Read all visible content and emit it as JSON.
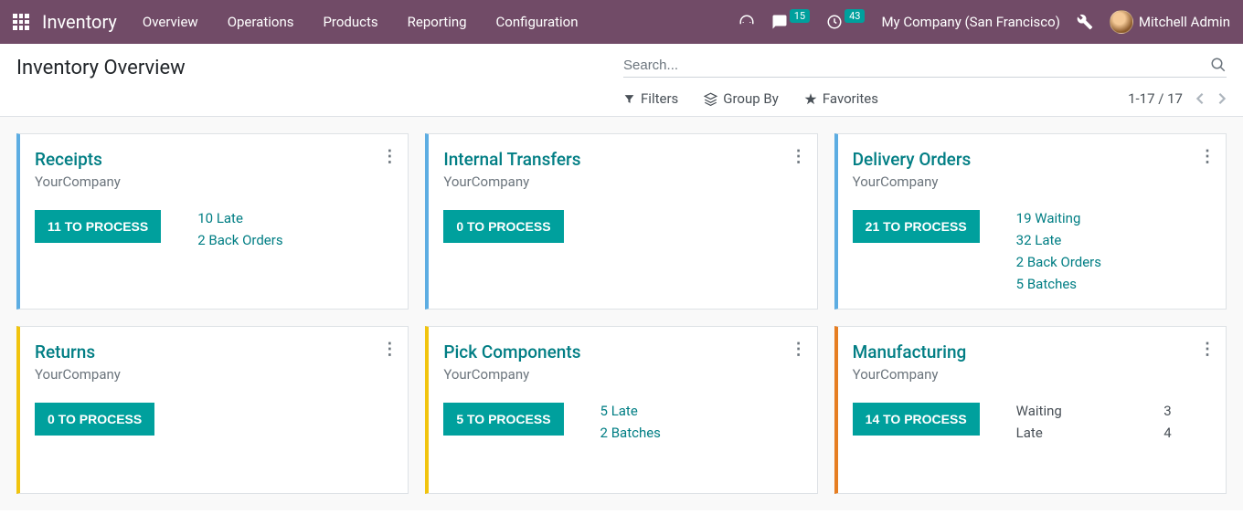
{
  "nav": {
    "brand": "Inventory",
    "menu": [
      "Overview",
      "Operations",
      "Products",
      "Reporting",
      "Configuration"
    ],
    "messages_badge": "15",
    "activities_badge": "43",
    "company": "My Company (San Francisco)",
    "user": "Mitchell Admin"
  },
  "page": {
    "title": "Inventory Overview",
    "search_placeholder": "Search...",
    "filters": "Filters",
    "groupby": "Group By",
    "favorites": "Favorites",
    "pager": "1-17 / 17"
  },
  "cards": [
    {
      "title": "Receipts",
      "sub": "YourCompany",
      "color": "blue",
      "button": "11 TO PROCESS",
      "links": [
        "10 Late",
        "2 Back Orders"
      ],
      "rows": []
    },
    {
      "title": "Internal Transfers",
      "sub": "YourCompany",
      "color": "blue",
      "button": "0 TO PROCESS",
      "links": [],
      "rows": []
    },
    {
      "title": "Delivery Orders",
      "sub": "YourCompany",
      "color": "blue",
      "button": "21 TO PROCESS",
      "links": [
        "19 Waiting",
        "32 Late",
        "2 Back Orders",
        "5 Batches"
      ],
      "rows": []
    },
    {
      "title": "Returns",
      "sub": "YourCompany",
      "color": "yellow",
      "button": "0 TO PROCESS",
      "links": [],
      "rows": []
    },
    {
      "title": "Pick Components",
      "sub": "YourCompany",
      "color": "yellow",
      "button": "5 TO PROCESS",
      "links": [
        "5 Late",
        "2 Batches"
      ],
      "rows": []
    },
    {
      "title": "Manufacturing",
      "sub": "YourCompany",
      "color": "orange",
      "button": "14 TO PROCESS",
      "links": [],
      "rows": [
        [
          "Waiting",
          "3"
        ],
        [
          "Late",
          "4"
        ]
      ]
    }
  ]
}
